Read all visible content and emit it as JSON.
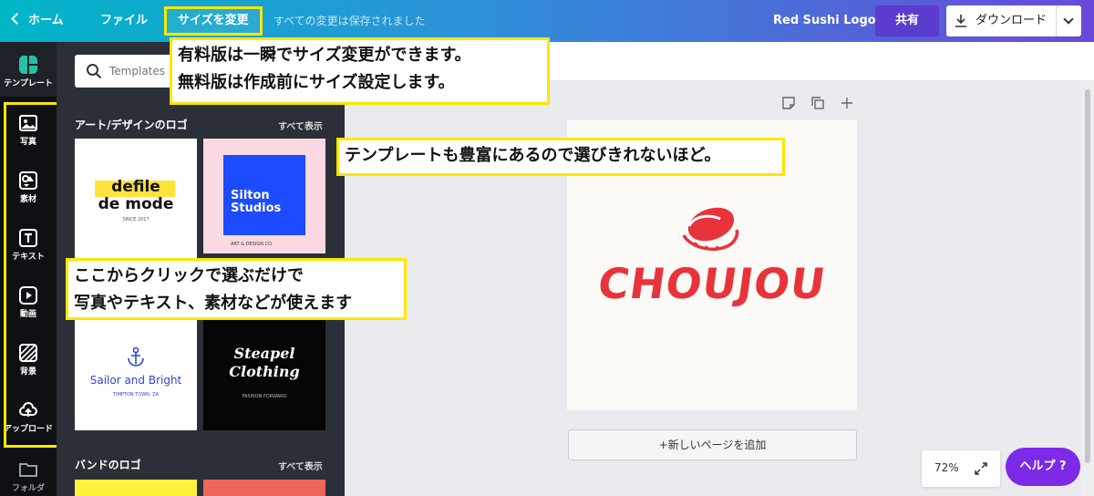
{
  "topbar": {
    "home": "ホーム",
    "file": "ファイル",
    "resize": "サイズを変更",
    "saved": "すべての変更は保存されました",
    "logo_name": "Red Sushi Logo",
    "share": "共有",
    "download": "ダウンロード"
  },
  "rail": {
    "templates": "テンプレート",
    "items": [
      "写真",
      "素材",
      "テキスト",
      "動画",
      "背景",
      "アップロード",
      "フォルダ"
    ]
  },
  "panel": {
    "search_placeholder": "Templates",
    "section1_title": "アート/デザインのロゴ",
    "section1_more": "すべて表示",
    "section2_title": "バンドのロゴ",
    "section2_more": "すべて表示",
    "thumbs": {
      "t1_line1": "defile",
      "t1_line2": "de mode",
      "t1_sub": "SINCE 2017",
      "t2_line1": "Silton",
      "t2_line2": "Studios",
      "t2_sub": "ART & DESIGN CO.",
      "t3_title": "Sailor and Bright",
      "t3_sub": "TIMPTON TOWN, ZA",
      "t4_line1": "Steapel",
      "t4_line2": "Clothing",
      "t4_sub": "FASHION FORWARD"
    }
  },
  "canvas": {
    "logo_text": "CHOUJOU",
    "add_page": "+新しいページを追加",
    "zoom": "72%",
    "help": "ヘルプ ?"
  },
  "notes": {
    "resize_line1": "有料版は一瞬でサイズ変更ができます。",
    "resize_line2": "無料版は作成前にサイズ設定します。",
    "templates": "テンプレートも豊富にあるので選びきれないほど。",
    "click_line1": "ここからクリックで選ぶだけで",
    "click_line2": "写真やテキスト、素材などが使えます"
  },
  "colors": {
    "accent_purple": "#7d2ae8",
    "highlight_yellow": "#ffe600",
    "logo_red": "#e8333b"
  }
}
